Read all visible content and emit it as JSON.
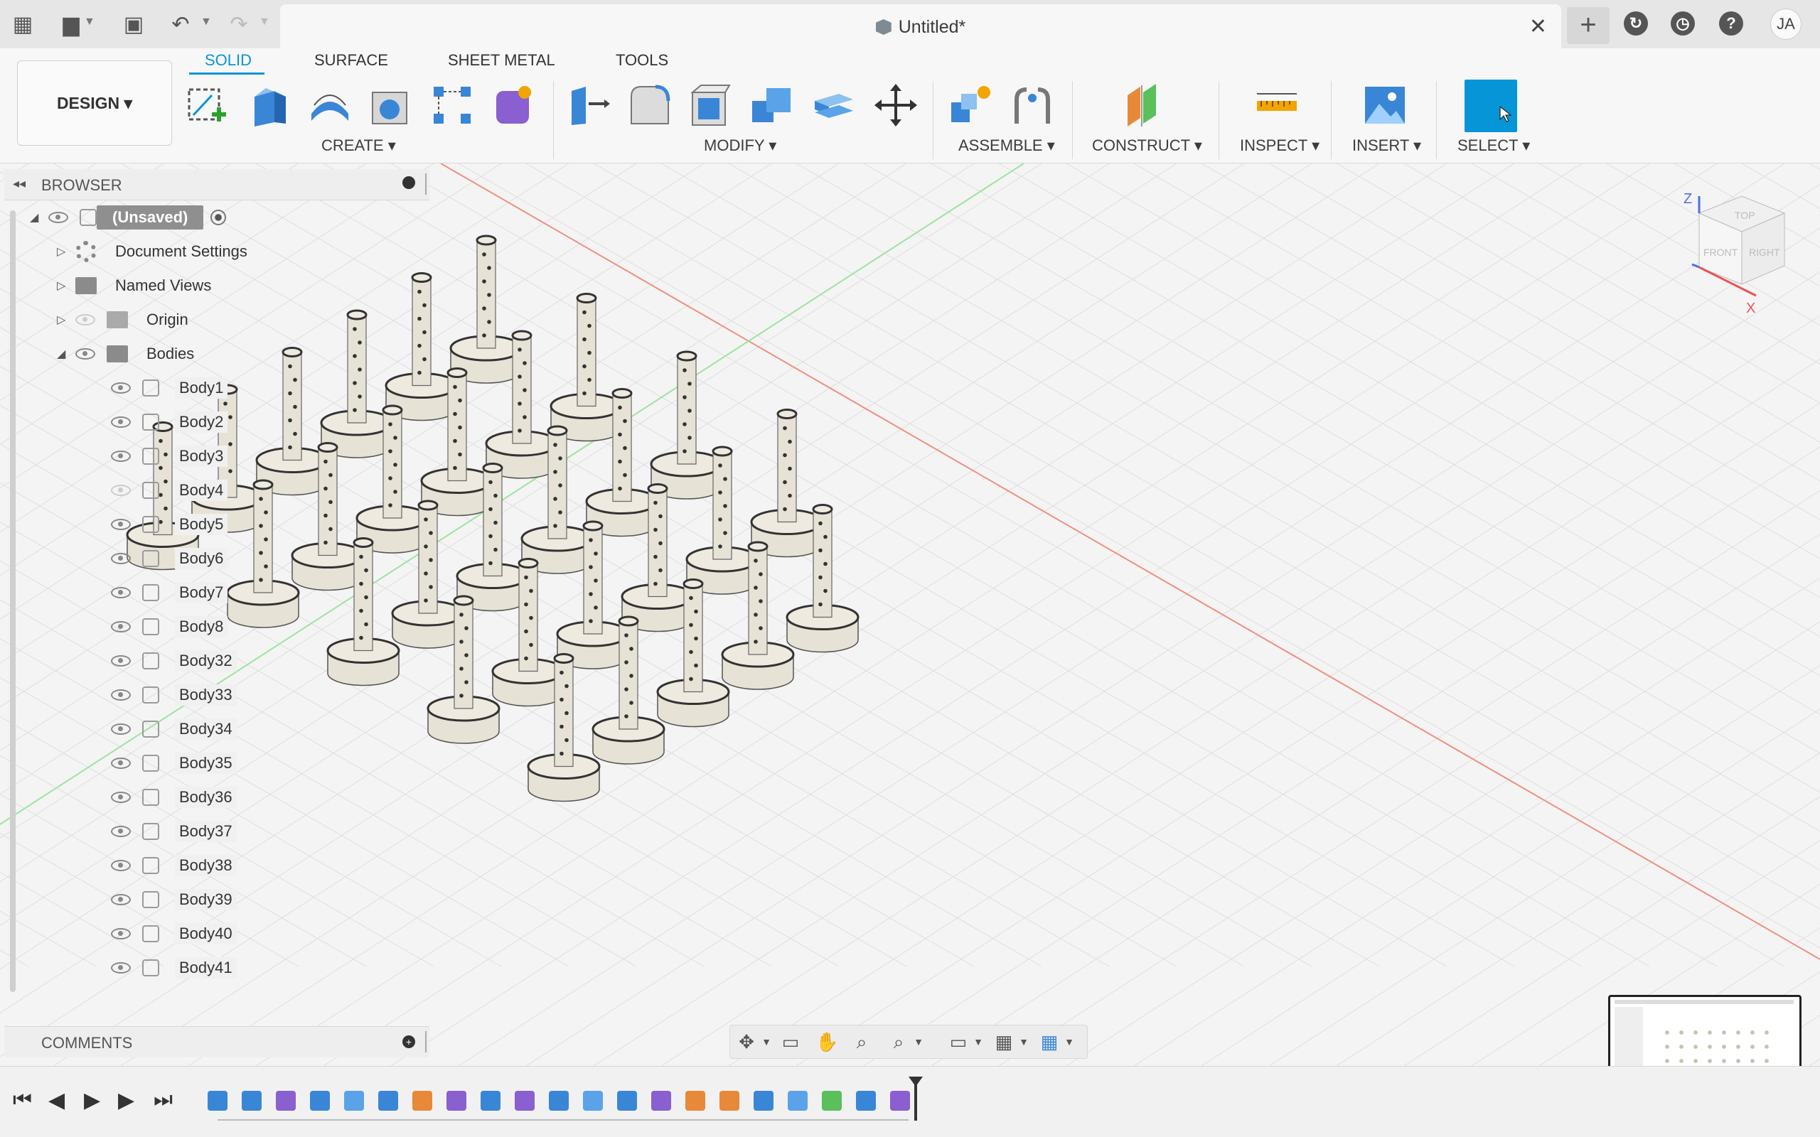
{
  "window": {
    "title": "Untitled*",
    "user_initials": "JA"
  },
  "toolbar": {
    "workspace_label": "DESIGN ▾",
    "tabs": [
      "SOLID",
      "SURFACE",
      "SHEET METAL",
      "TOOLS"
    ],
    "groups": [
      "CREATE ▾",
      "MODIFY ▾",
      "ASSEMBLE ▾",
      "CONSTRUCT ▾",
      "INSPECT ▾",
      "INSERT ▾",
      "SELECT ▾"
    ]
  },
  "browser": {
    "title": "BROWSER",
    "root": "(Unsaved)",
    "folders": [
      "Document Settings",
      "Named Views",
      "Origin",
      "Bodies"
    ],
    "bodies": [
      "Body1",
      "Body2",
      "Body3",
      "Body4",
      "Body5",
      "Body6",
      "Body7",
      "Body8",
      "Body32",
      "Body33",
      "Body34",
      "Body35",
      "Body36",
      "Body37",
      "Body38",
      "Body39",
      "Body40",
      "Body41"
    ],
    "hidden_bodies": [
      "Body4"
    ]
  },
  "comments": {
    "title": "COMMENTS"
  },
  "viewcube": {
    "labels": [
      "TOP",
      "FRONT",
      "RIGHT"
    ],
    "axes": [
      "Z",
      "X"
    ]
  },
  "colors": {
    "accent": "#0696d7",
    "part": "#e7e2d6",
    "grid": "#dedede"
  }
}
